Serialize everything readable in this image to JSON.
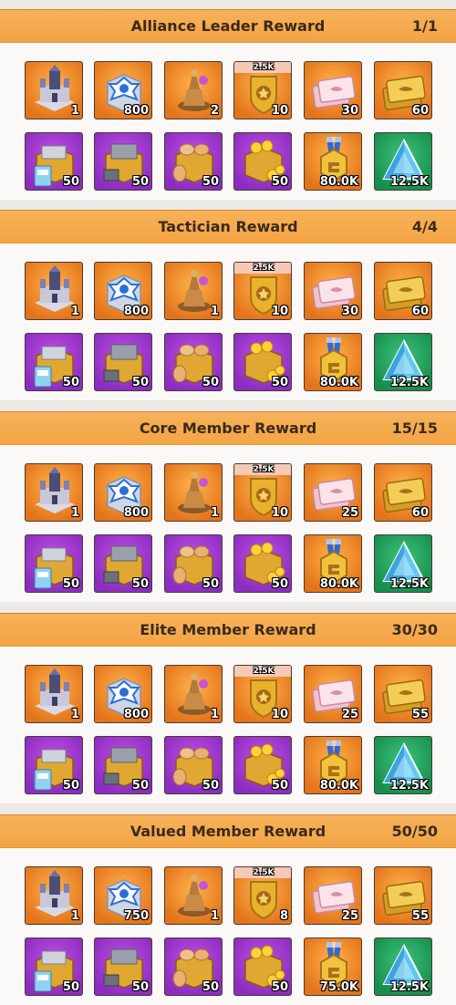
{
  "sections": [
    {
      "title": "Alliance Leader Reward",
      "progress": "1/1",
      "items": [
        {
          "icon": "castle-skin-icon",
          "bg": "orange",
          "qty": "1"
        },
        {
          "icon": "silver-star-chest-icon",
          "bg": "orange",
          "qty": "800"
        },
        {
          "icon": "tower-decoration-icon",
          "bg": "orange",
          "qty": "2"
        },
        {
          "icon": "gold-badge-icon",
          "bg": "orange",
          "qty": "10",
          "tag": "2.5K"
        },
        {
          "icon": "pink-card-icon",
          "bg": "orange",
          "qty": "30"
        },
        {
          "icon": "gold-card-icon",
          "bg": "orange",
          "qty": "60"
        },
        {
          "icon": "stone-supply-box-icon",
          "bg": "purple",
          "qty": "50"
        },
        {
          "icon": "iron-supply-box-icon",
          "bg": "purple",
          "qty": "50"
        },
        {
          "icon": "food-supply-box-icon",
          "bg": "purple",
          "qty": "50"
        },
        {
          "icon": "gold-supply-box-icon",
          "bg": "purple",
          "qty": "50"
        },
        {
          "icon": "honor-medal-icon",
          "bg": "orange",
          "qty": "80.0K"
        },
        {
          "icon": "blue-crystal-icon",
          "bg": "green",
          "qty": "12.5K"
        }
      ]
    },
    {
      "title": "Tactician Reward",
      "progress": "4/4",
      "items": [
        {
          "icon": "castle-skin-icon",
          "bg": "orange",
          "qty": "1"
        },
        {
          "icon": "silver-star-chest-icon",
          "bg": "orange",
          "qty": "800"
        },
        {
          "icon": "tower-decoration-icon",
          "bg": "orange",
          "qty": "1"
        },
        {
          "icon": "gold-badge-icon",
          "bg": "orange",
          "qty": "10",
          "tag": "2.5K"
        },
        {
          "icon": "pink-card-icon",
          "bg": "orange",
          "qty": "30"
        },
        {
          "icon": "gold-card-icon",
          "bg": "orange",
          "qty": "60"
        },
        {
          "icon": "stone-supply-box-icon",
          "bg": "purple",
          "qty": "50"
        },
        {
          "icon": "iron-supply-box-icon",
          "bg": "purple",
          "qty": "50"
        },
        {
          "icon": "food-supply-box-icon",
          "bg": "purple",
          "qty": "50"
        },
        {
          "icon": "gold-supply-box-icon",
          "bg": "purple",
          "qty": "50"
        },
        {
          "icon": "honor-medal-icon",
          "bg": "orange",
          "qty": "80.0K"
        },
        {
          "icon": "blue-crystal-icon",
          "bg": "green",
          "qty": "12.5K"
        }
      ]
    },
    {
      "title": "Core Member Reward",
      "progress": "15/15",
      "items": [
        {
          "icon": "castle-skin-icon",
          "bg": "orange",
          "qty": "1"
        },
        {
          "icon": "silver-star-chest-icon",
          "bg": "orange",
          "qty": "800"
        },
        {
          "icon": "tower-decoration-icon",
          "bg": "orange",
          "qty": "1"
        },
        {
          "icon": "gold-badge-icon",
          "bg": "orange",
          "qty": "10",
          "tag": "2.5K"
        },
        {
          "icon": "pink-card-icon",
          "bg": "orange",
          "qty": "25"
        },
        {
          "icon": "gold-card-icon",
          "bg": "orange",
          "qty": "60"
        },
        {
          "icon": "stone-supply-box-icon",
          "bg": "purple",
          "qty": "50"
        },
        {
          "icon": "iron-supply-box-icon",
          "bg": "purple",
          "qty": "50"
        },
        {
          "icon": "food-supply-box-icon",
          "bg": "purple",
          "qty": "50"
        },
        {
          "icon": "gold-supply-box-icon",
          "bg": "purple",
          "qty": "50"
        },
        {
          "icon": "honor-medal-icon",
          "bg": "orange",
          "qty": "80.0K"
        },
        {
          "icon": "blue-crystal-icon",
          "bg": "green",
          "qty": "12.5K"
        }
      ]
    },
    {
      "title": "Elite Member Reward",
      "progress": "30/30",
      "items": [
        {
          "icon": "castle-skin-icon",
          "bg": "orange",
          "qty": "1"
        },
        {
          "icon": "silver-star-chest-icon",
          "bg": "orange",
          "qty": "800"
        },
        {
          "icon": "tower-decoration-icon",
          "bg": "orange",
          "qty": "1"
        },
        {
          "icon": "gold-badge-icon",
          "bg": "orange",
          "qty": "10",
          "tag": "2.5K"
        },
        {
          "icon": "pink-card-icon",
          "bg": "orange",
          "qty": "25"
        },
        {
          "icon": "gold-card-icon",
          "bg": "orange",
          "qty": "55"
        },
        {
          "icon": "stone-supply-box-icon",
          "bg": "purple",
          "qty": "50"
        },
        {
          "icon": "iron-supply-box-icon",
          "bg": "purple",
          "qty": "50"
        },
        {
          "icon": "food-supply-box-icon",
          "bg": "purple",
          "qty": "50"
        },
        {
          "icon": "gold-supply-box-icon",
          "bg": "purple",
          "qty": "50"
        },
        {
          "icon": "honor-medal-icon",
          "bg": "orange",
          "qty": "80.0K"
        },
        {
          "icon": "blue-crystal-icon",
          "bg": "green",
          "qty": "12.5K"
        }
      ]
    },
    {
      "title": "Valued Member Reward",
      "progress": "50/50",
      "items": [
        {
          "icon": "castle-skin-icon",
          "bg": "orange",
          "qty": "1"
        },
        {
          "icon": "silver-star-chest-icon",
          "bg": "orange",
          "qty": "750"
        },
        {
          "icon": "tower-decoration-icon",
          "bg": "orange",
          "qty": "1"
        },
        {
          "icon": "gold-badge-icon",
          "bg": "orange",
          "qty": "8",
          "tag": "2.5K"
        },
        {
          "icon": "pink-card-icon",
          "bg": "orange",
          "qty": "25"
        },
        {
          "icon": "gold-card-icon",
          "bg": "orange",
          "qty": "55"
        },
        {
          "icon": "stone-supply-box-icon",
          "bg": "purple",
          "qty": "50"
        },
        {
          "icon": "iron-supply-box-icon",
          "bg": "purple",
          "qty": "50"
        },
        {
          "icon": "food-supply-box-icon",
          "bg": "purple",
          "qty": "50"
        },
        {
          "icon": "gold-supply-box-icon",
          "bg": "purple",
          "qty": "50"
        },
        {
          "icon": "honor-medal-icon",
          "bg": "orange",
          "qty": "75.0K"
        },
        {
          "icon": "blue-crystal-icon",
          "bg": "green",
          "qty": "12.5K"
        }
      ]
    }
  ],
  "colors": {
    "header": "#f3a444",
    "slot_orange": "#e3741b",
    "slot_purple": "#8a2dc0",
    "slot_green": "#168f4e"
  }
}
